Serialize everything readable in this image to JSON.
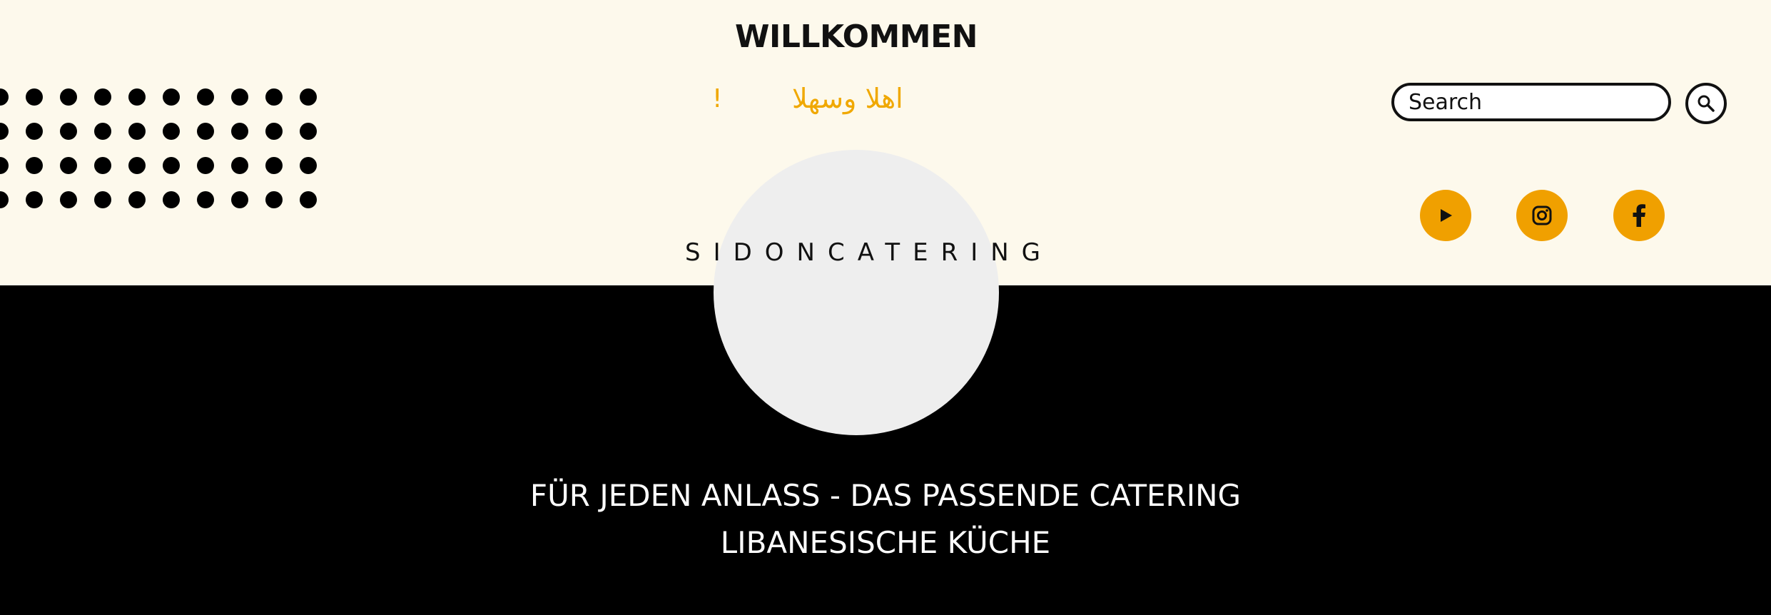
{
  "header": {
    "title": "WILLKOMMEN",
    "greeting_arabic": "اهلا وسهلا",
    "greeting_mark": "!"
  },
  "logo": {
    "text": "SIDONCATERING"
  },
  "search": {
    "placeholder": "Search",
    "button_icon": "search-icon"
  },
  "social": [
    {
      "name": "YouTube",
      "icon": "play-icon"
    },
    {
      "name": "Instagram",
      "icon": "instagram-icon"
    },
    {
      "name": "Facebook",
      "icon": "facebook-icon"
    }
  ],
  "tagline": {
    "line1": "FÜR JEDEN ANLASS - DAS PASSENDE CATERING",
    "line2": "LIBANESISCHE KÜCHE"
  },
  "colors": {
    "top_background": "#fdf9ec",
    "bottom_background": "#000000",
    "accent": "#f0a000",
    "logo_circle": "#eeeeee"
  }
}
